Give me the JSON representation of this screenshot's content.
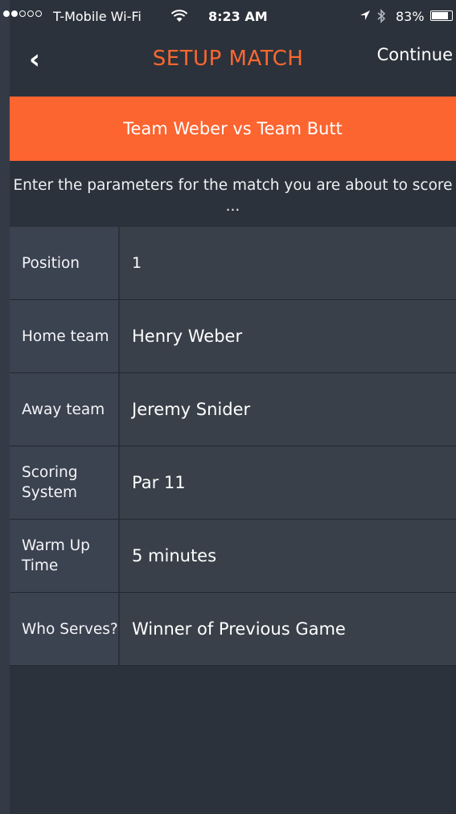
{
  "status_bar": {
    "carrier": "T-Mobile Wi-Fi",
    "time": "8:23 AM",
    "battery": "83%",
    "battery_level": 0.83,
    "signal_bars_filled": 2,
    "signal_bars_total": 5
  },
  "nav": {
    "back_glyph": "‹",
    "title": "SETUP MATCH",
    "continue_label": "Continue"
  },
  "banner": {
    "text": "Team Weber vs Team Butt"
  },
  "instructions": "Enter the parameters for the match you are about to score ...",
  "parameters": [
    {
      "label": "Position",
      "value": "1"
    },
    {
      "label": "Home team",
      "value": "Henry Weber"
    },
    {
      "label": "Away team",
      "value": "Jeremy Snider"
    },
    {
      "label": "Scoring System",
      "value": "Par 11"
    },
    {
      "label": "Warm Up Time",
      "value": "5 minutes"
    },
    {
      "label": "Who Serves?",
      "value": "Winner of Previous Game"
    }
  ],
  "colors": {
    "accent": "#fc6430",
    "background": "#2c323b",
    "label_cell": "#3b4250",
    "value_cell": "#394049"
  },
  "icons": {
    "wifi": "wifi-icon",
    "location": "location-arrow-icon",
    "bluetooth": "bluetooth-icon",
    "battery": "battery-icon",
    "back": "chevron-left-icon"
  }
}
